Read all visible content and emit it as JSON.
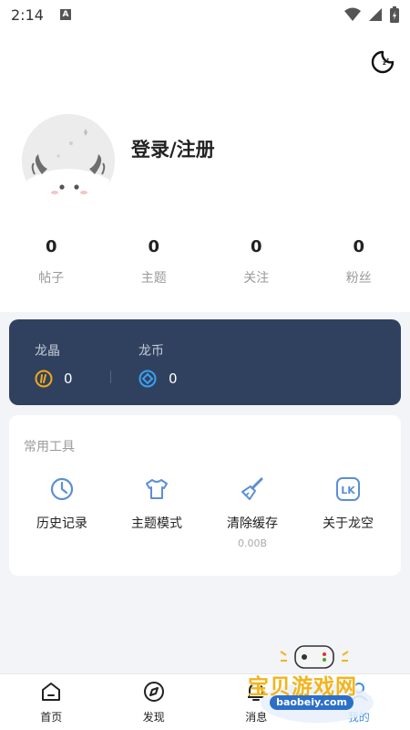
{
  "status_bar": {
    "time": "2:14",
    "notif_letter": "A"
  },
  "profile": {
    "login_label": "登录/注册"
  },
  "stats": [
    {
      "value": "0",
      "label": "帖子"
    },
    {
      "value": "0",
      "label": "主题"
    },
    {
      "value": "0",
      "label": "关注"
    },
    {
      "value": "0",
      "label": "粉丝"
    }
  ],
  "wallet": {
    "crystal": {
      "label": "龙晶",
      "value": "0",
      "color": "#f2a818"
    },
    "coin": {
      "label": "龙币",
      "value": "0",
      "color": "#3aa0f0"
    }
  },
  "tools": {
    "title": "常用工具",
    "items": [
      {
        "label": "历史记录",
        "icon": "clock-icon"
      },
      {
        "label": "主题模式",
        "icon": "tshirt-icon"
      },
      {
        "label": "清除缓存",
        "icon": "brush-icon",
        "sub": "0.00B"
      },
      {
        "label": "关于龙空",
        "icon": "lk-logo-icon",
        "logo_text": "LK"
      }
    ]
  },
  "nav": [
    {
      "label": "首页",
      "icon": "home-icon"
    },
    {
      "label": "发现",
      "icon": "compass-icon"
    },
    {
      "label": "消息",
      "icon": "bell-icon"
    },
    {
      "label": "我的",
      "icon": "profile-icon",
      "active": true
    }
  ],
  "watermark": {
    "text": "宝贝游戏网",
    "url": "baobeiy.com"
  },
  "colors": {
    "accent": "#3d8fe0",
    "wallet_bg": "#304160",
    "icon_blue": "#5b8fd6"
  }
}
